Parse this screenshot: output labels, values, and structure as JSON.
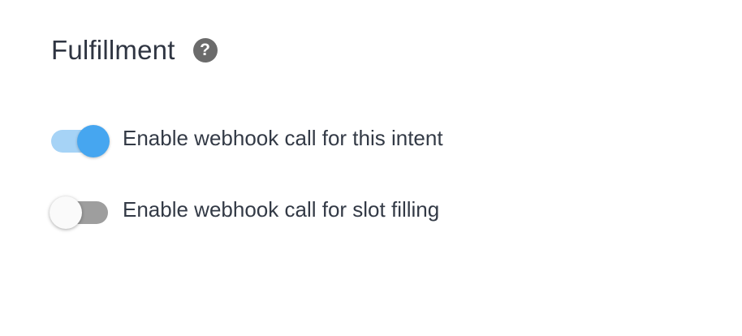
{
  "section": {
    "title": "Fulfillment",
    "help_icon": "question-circle-icon"
  },
  "toggles": [
    {
      "label": "Enable webhook call for this intent",
      "enabled": true
    },
    {
      "label": "Enable webhook call for slot filling",
      "enabled": false
    }
  ],
  "colors": {
    "toggle_on_knob": "#46a6f0",
    "toggle_on_track": "#a6d3f6",
    "toggle_off_knob": "#fafafa",
    "toggle_off_track": "#9e9e9e",
    "text": "#2f3542",
    "help_icon": "#6b6b6b"
  }
}
